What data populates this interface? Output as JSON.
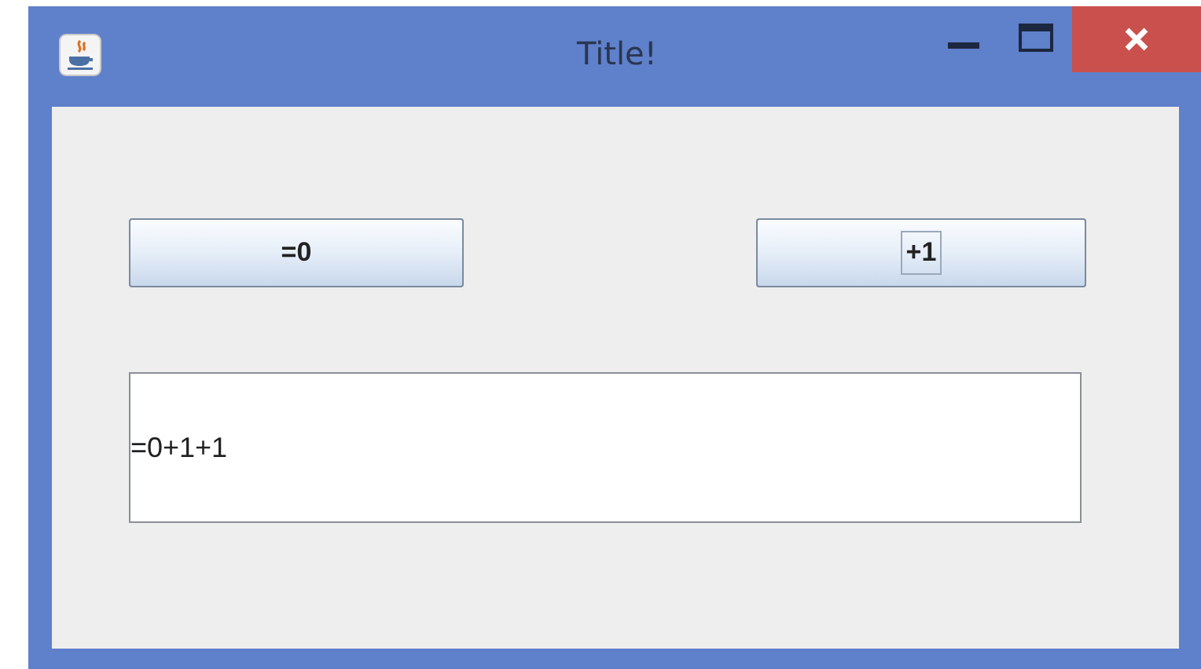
{
  "window": {
    "title": "Title!"
  },
  "buttons": [
    {
      "label": "=0",
      "focused": false
    },
    {
      "label": "+1",
      "focused": true
    }
  ],
  "output": {
    "value": "=0+1+1"
  }
}
